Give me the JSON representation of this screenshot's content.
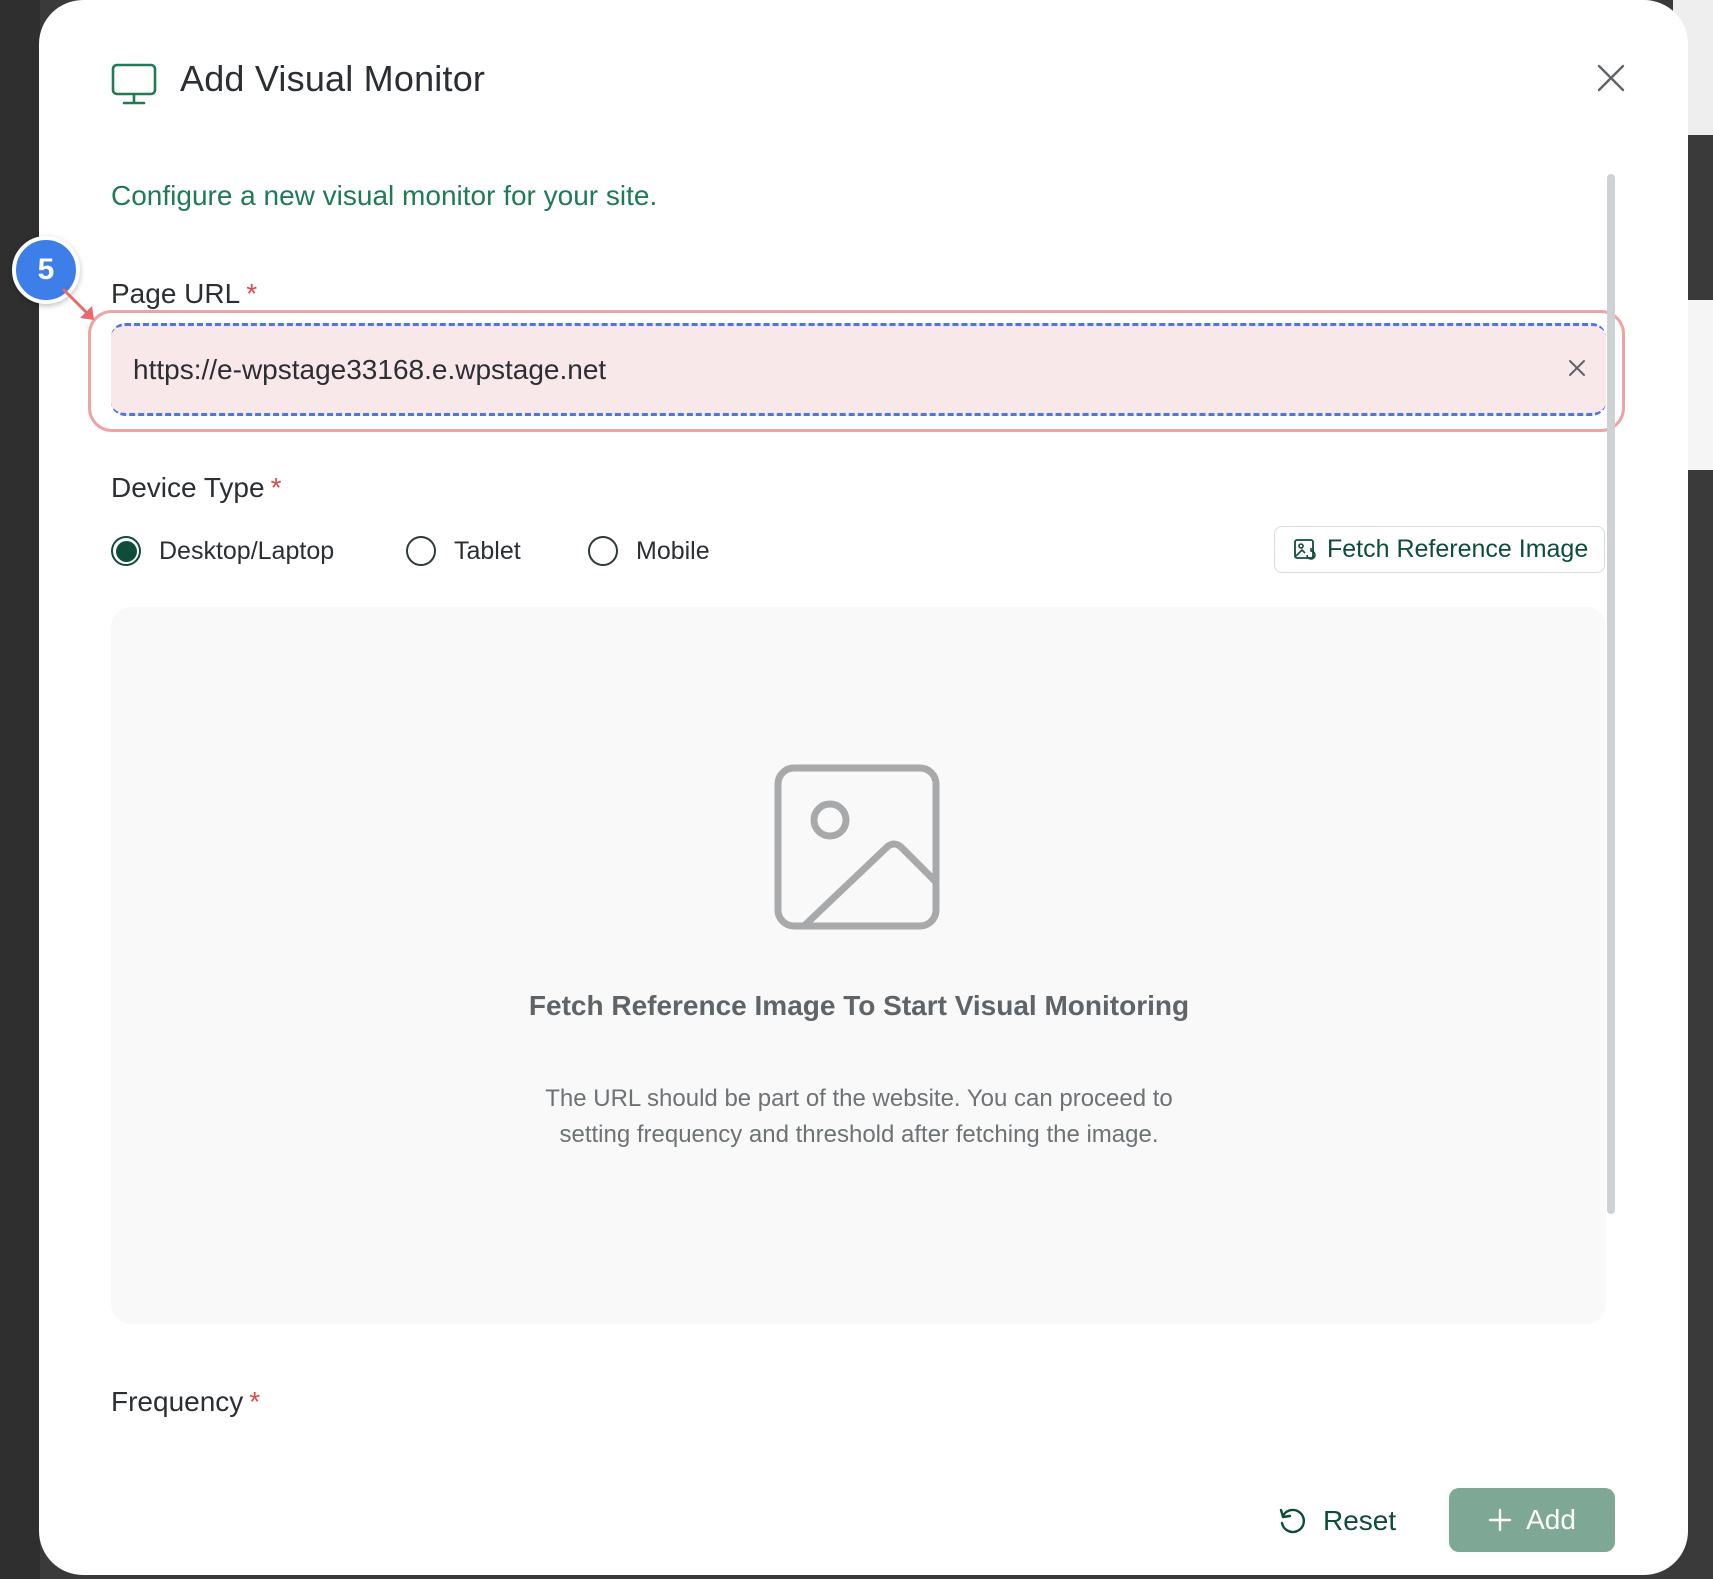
{
  "modal": {
    "title": "Add Visual Monitor",
    "subtitle": "Configure a new visual monitor for your site.",
    "close_icon": "close-icon"
  },
  "fields": {
    "page_url": {
      "label": "Page URL",
      "required_mark": "*",
      "value": "https://e-wpstage33168.e.wpstage.net"
    },
    "device_type": {
      "label": "Device Type",
      "required_mark": "*",
      "options": [
        {
          "label": "Desktop/Laptop",
          "checked": true
        },
        {
          "label": "Tablet",
          "checked": false
        },
        {
          "label": "Mobile",
          "checked": false
        }
      ]
    },
    "frequency": {
      "label": "Frequency",
      "required_mark": "*"
    }
  },
  "fetch_button": {
    "label": "Fetch Reference Image",
    "icon": "image-refresh-icon"
  },
  "placeholder": {
    "title": "Fetch Reference Image To Start Visual Monitoring",
    "description": "The URL should be part of the website. You can proceed to setting frequency and threshold after fetching the image.",
    "icon": "image-placeholder-icon"
  },
  "footer": {
    "reset_label": "Reset",
    "add_label": "Add"
  },
  "annotation": {
    "step_number": "5"
  },
  "colors": {
    "accent": "#0f4d3a",
    "subtitle": "#1f7a55",
    "required": "#e04848",
    "add_button": "#7fa796",
    "step_badge": "#3d7ee8",
    "highlight": "#f0a3a3"
  }
}
